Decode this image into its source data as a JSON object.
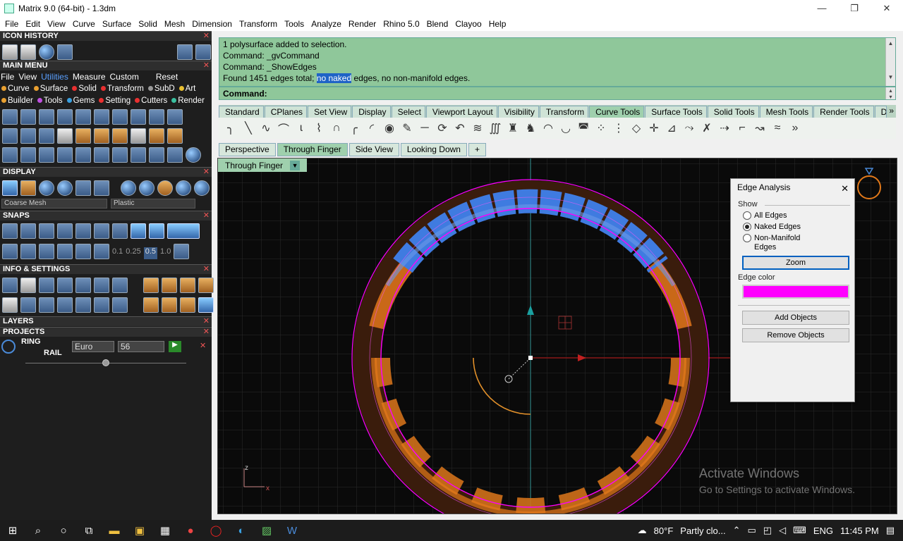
{
  "window": {
    "title": "Matrix 9.0 (64-bit) - 1.3dm",
    "minimize": "—",
    "restore": "❐",
    "close": "✕"
  },
  "menubar": [
    "File",
    "Edit",
    "View",
    "Curve",
    "Surface",
    "Solid",
    "Mesh",
    "Dimension",
    "Transform",
    "Tools",
    "Analyze",
    "Render",
    "Rhino 5.0",
    "Blend",
    "Clayoo",
    "Help"
  ],
  "left": {
    "icon_history": "ICON HISTORY",
    "main_menu": "MAIN MENU",
    "main_tabs": [
      "File",
      "View",
      "Utilities",
      "Measure",
      "Custom"
    ],
    "reset": "Reset",
    "row1": [
      "Curve",
      "Surface",
      "Solid",
      "Transform",
      "SubD",
      "Art"
    ],
    "row2": [
      "Builder",
      "Tools",
      "Gems",
      "Setting",
      "Cutters",
      "Render"
    ],
    "display": "DISPLAY",
    "display_mode": "Coarse Mesh",
    "material": "Plastic",
    "snaps": "SNAPS",
    "snap_values": [
      "0.1",
      "0.25",
      "0.5",
      "1.0"
    ],
    "info": "INFO & SETTINGS",
    "layers": "LAYERS",
    "projects": "PROJECTS",
    "ring_label": "RING",
    "rail_label": "RAIL",
    "sizing": "Euro",
    "size": "56"
  },
  "command": {
    "lines": [
      "1 polysurface added to selection.",
      "Command: _gvCommand",
      "Command: _ShowEdges"
    ],
    "last_prefix": "Found 1451 edges total; ",
    "last_hl": "no naked",
    "last_suffix": " edges, no non-manifold edges.",
    "prompt": "Command:"
  },
  "toolbar_tabs": [
    "Standard",
    "CPlanes",
    "Set View",
    "Display",
    "Select",
    "Viewport Layout",
    "Visibility",
    "Transform",
    "Curve Tools",
    "Surface Tools",
    "Solid Tools",
    "Mesh Tools",
    "Render Tools",
    "Draftin"
  ],
  "active_toolbar_tab": "Curve Tools",
  "viewport_tabs": [
    "Perspective",
    "Through Finger",
    "Side View",
    "Looking Down"
  ],
  "active_viewport": "Through Finger",
  "viewport_label": "Through Finger",
  "edge_dialog": {
    "title": "Edge Analysis",
    "show": "Show",
    "all": "All Edges",
    "naked": "Naked Edges",
    "nonmanifold_1": "Non-Manifold",
    "nonmanifold_2": "Edges",
    "selected": "naked",
    "zoom": "Zoom",
    "edge_color_label": "Edge color",
    "edge_color": "#ff00ff",
    "add": "Add Objects",
    "remove": "Remove Objects"
  },
  "watermark": {
    "line1": "Activate Windows",
    "line2": "Go to Settings to activate Windows."
  },
  "taskbar": {
    "temp": "80°F",
    "weather": "Partly clo...",
    "lang": "ENG",
    "time": "11:45 PM"
  },
  "colors": {
    "command_bg": "#8fc79a",
    "ring_orange": "#e2791a",
    "ring_blue": "#3f7be0",
    "edge_magenta": "#ff00ff"
  }
}
